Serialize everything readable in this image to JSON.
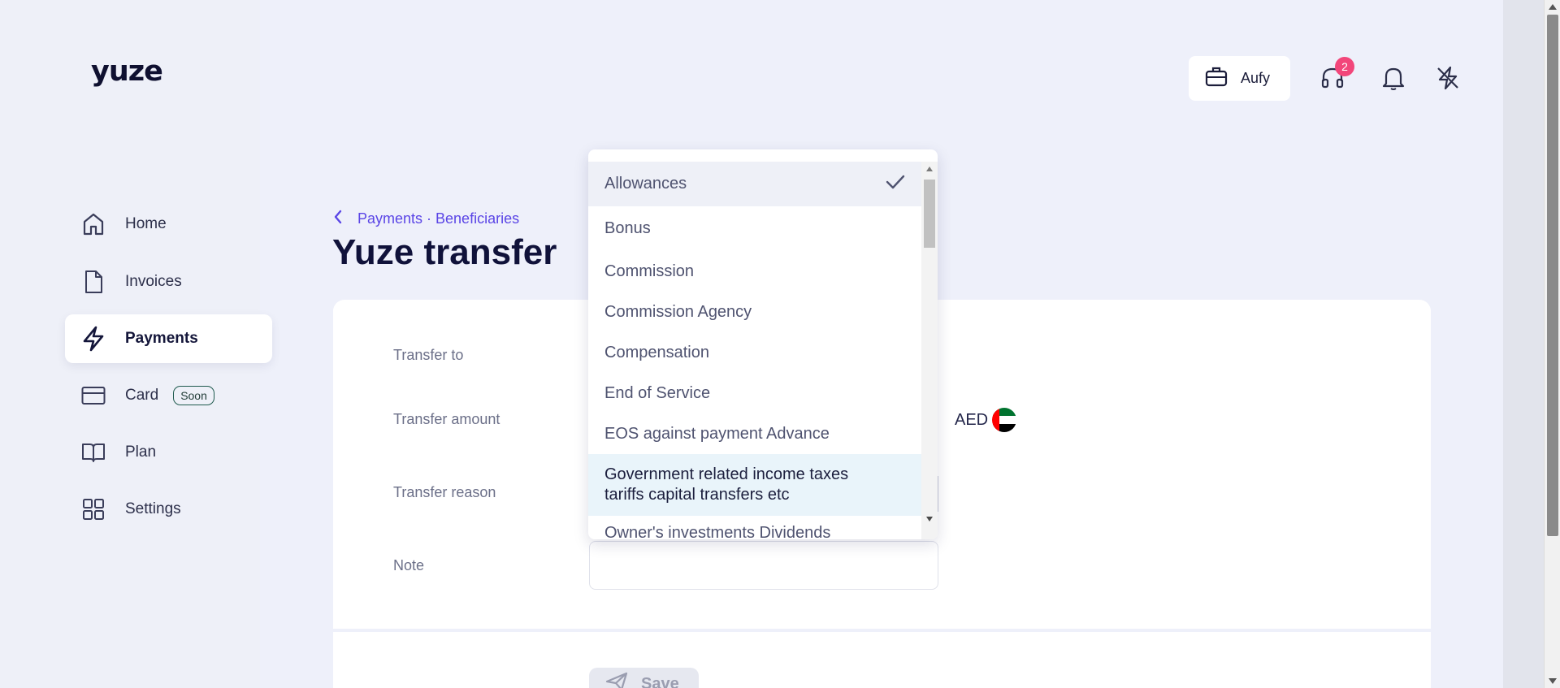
{
  "brand": {
    "logo": "yuze"
  },
  "sidebar": {
    "items": [
      {
        "label": "Home",
        "icon": "home-icon"
      },
      {
        "label": "Invoices",
        "icon": "document-icon"
      },
      {
        "label": "Payments",
        "icon": "lightning-icon",
        "active": true
      },
      {
        "label": "Card",
        "icon": "card-icon",
        "badge": "Soon"
      },
      {
        "label": "Plan",
        "icon": "book-icon"
      },
      {
        "label": "Settings",
        "icon": "grid-icon"
      }
    ]
  },
  "header": {
    "account_label": "Aufy",
    "support_badge_count": "2"
  },
  "breadcrumb": {
    "text": "Payments · Beneficiaries"
  },
  "page_title": "Yuze transfer",
  "form": {
    "transfer_to_label": "Transfer to",
    "transfer_amount_label": "Transfer amount",
    "currency": "AED",
    "transfer_reason_label": "Transfer reason",
    "note_label": "Note",
    "save_label": "Save"
  },
  "dropdown": {
    "options": [
      "Allowances",
      "Bonus",
      "Commission",
      "Commission Agency",
      "Compensation",
      "End of Service",
      "EOS against payment Advance",
      "Government related income taxes tariffs capital transfers etc",
      "Owner's investments Dividends"
    ],
    "selected": "Allowances",
    "hovered": "Government related income taxes tariffs capital transfers etc"
  },
  "colors": {
    "accent": "#5a45e6",
    "badge": "#f2467a",
    "title": "#10123a"
  }
}
